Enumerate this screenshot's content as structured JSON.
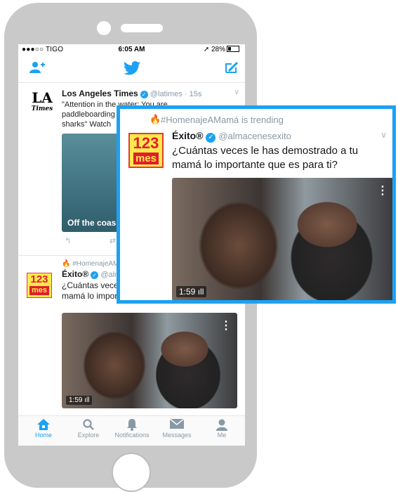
{
  "status": {
    "carrier": "●●●○○ TIGO",
    "time": "6:05 AM",
    "battery": "28%"
  },
  "nav": {
    "follow_icon": "add-user-icon",
    "logo_icon": "twitter-bird-icon",
    "compose_icon": "compose-icon"
  },
  "tweet1": {
    "avatar_big": "LA",
    "avatar_small": "Times",
    "name": "Los Angeles Times",
    "handle": "@latimes · 15s",
    "text_line1": "\"Attention in the water:",
    "text_line1b": "You are",
    "text_line2": "paddleboarding",
    "text_line3": "sharks\" Watch",
    "media_caption": "Off the coas"
  },
  "tweet2": {
    "trend": "#HomenajeAMam",
    "name": "Éxito®",
    "handle": "@alma",
    "text_line1": "¿Cuántas vece",
    "text_line2": "mamá lo impor",
    "video_time": "1:59"
  },
  "avatar_exito": {
    "num": "123",
    "word": "mes"
  },
  "zoom": {
    "trend": "#HomenajeAMamá is trending",
    "name": "Éxito®",
    "handle": "@almacenesexito",
    "text_line1": "¿Cuántas veces le has demostrado a tu",
    "text_line2": "mamá lo importante que es para ti?",
    "video_time": "1:59"
  },
  "tabs": [
    {
      "label": "Home",
      "icon": "home-icon"
    },
    {
      "label": "Explore",
      "icon": "search-icon"
    },
    {
      "label": "Notifications",
      "icon": "bell-icon"
    },
    {
      "label": "Messages",
      "icon": "envelope-icon"
    },
    {
      "label": "Me",
      "icon": "person-icon"
    }
  ],
  "colors": {
    "accent": "#1da1f2",
    "phone": "#c9c9c9",
    "exito_red": "#e11d2e",
    "exito_yellow": "#ffe94d"
  }
}
